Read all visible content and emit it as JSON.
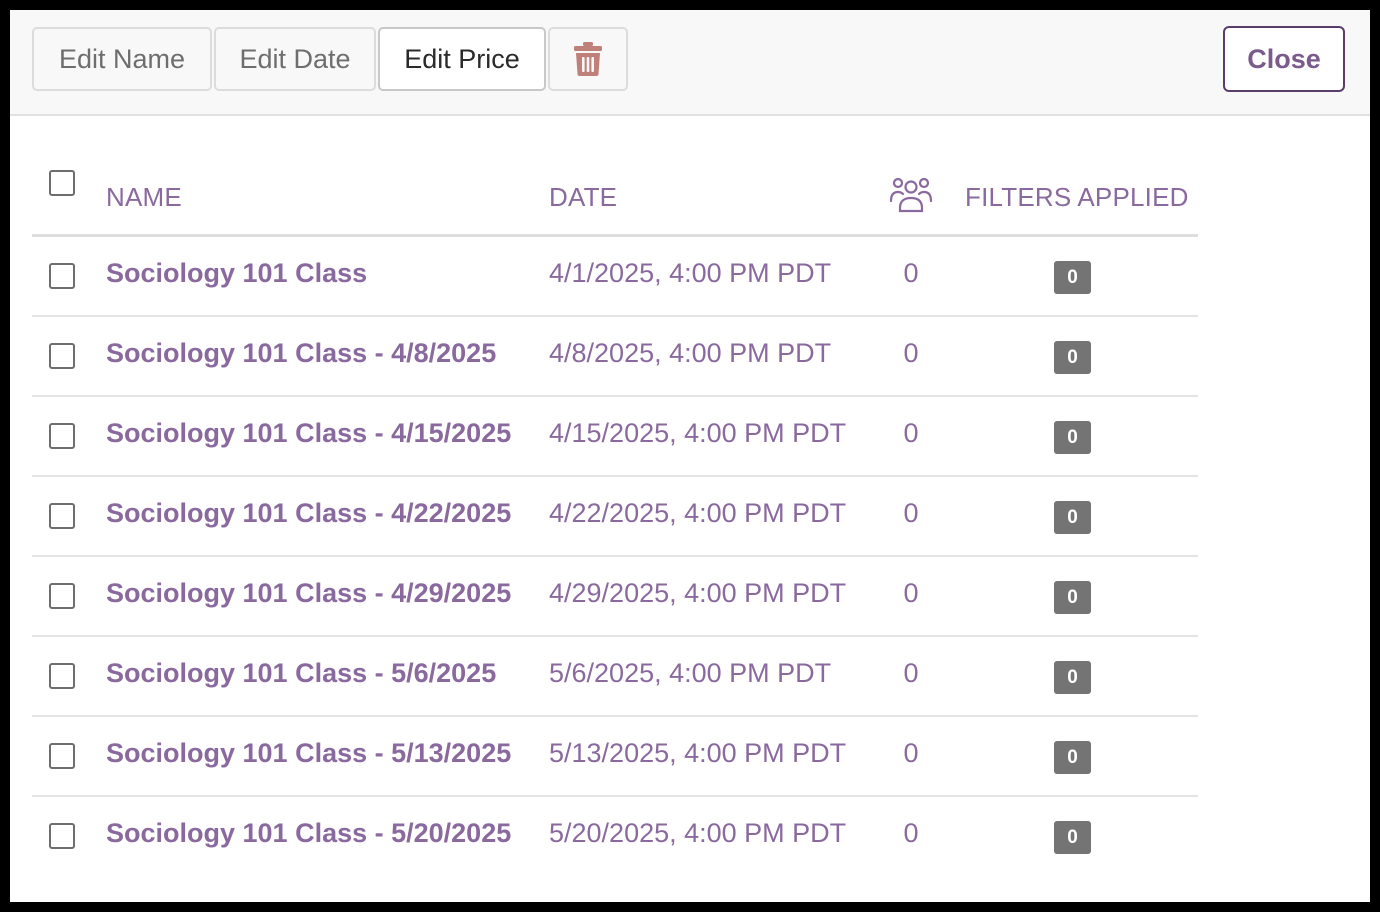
{
  "toolbar": {
    "edit_name_label": "Edit Name",
    "edit_date_label": "Edit Date",
    "edit_price_label": "Edit Price",
    "delete_icon": "trash-icon",
    "close_label": "Close"
  },
  "table": {
    "headers": {
      "name": "NAME",
      "date": "DATE",
      "attendees_icon": "people-icon",
      "filters": "FILTERS APPLIED"
    },
    "rows": [
      {
        "name": "Sociology 101 Class",
        "date": "4/1/2025, 4:00 PM PDT",
        "count": "0",
        "filters": "0"
      },
      {
        "name": "Sociology 101 Class - 4/8/2025",
        "date": "4/8/2025, 4:00 PM PDT",
        "count": "0",
        "filters": "0"
      },
      {
        "name": "Sociology 101 Class - 4/15/2025",
        "date": "4/15/2025, 4:00 PM PDT",
        "count": "0",
        "filters": "0"
      },
      {
        "name": "Sociology 101 Class - 4/22/2025",
        "date": "4/22/2025, 4:00 PM PDT",
        "count": "0",
        "filters": "0"
      },
      {
        "name": "Sociology 101 Class - 4/29/2025",
        "date": "4/29/2025, 4:00 PM PDT",
        "count": "0",
        "filters": "0"
      },
      {
        "name": "Sociology 101 Class - 5/6/2025",
        "date": "5/6/2025, 4:00 PM PDT",
        "count": "0",
        "filters": "0"
      },
      {
        "name": "Sociology 101 Class - 5/13/2025",
        "date": "5/13/2025, 4:00 PM PDT",
        "count": "0",
        "filters": "0"
      },
      {
        "name": "Sociology 101 Class - 5/20/2025",
        "date": "5/20/2025, 4:00 PM PDT",
        "count": "0",
        "filters": "0"
      }
    ]
  },
  "colors": {
    "accent": "#8a6a9e",
    "close_border": "#5a3d68",
    "delete_icon": "#c0807a",
    "badge": "#747474"
  }
}
